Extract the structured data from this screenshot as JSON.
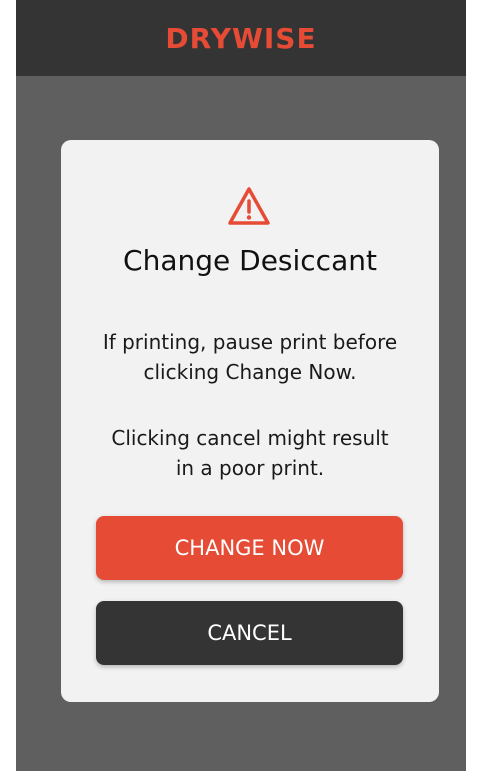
{
  "header": {
    "logo_text": "DRYWISE",
    "brand_color": "#e64b35"
  },
  "dialog": {
    "icon": "warning-triangle-icon",
    "title": "Change Desiccant",
    "message_line1a": "If printing, pause print before",
    "message_line1b": "clicking Change Now.",
    "message_line2a": "Clicking cancel might result",
    "message_line2b": "in a poor print.",
    "primary_button": "CHANGE NOW",
    "secondary_button": "CANCEL"
  }
}
